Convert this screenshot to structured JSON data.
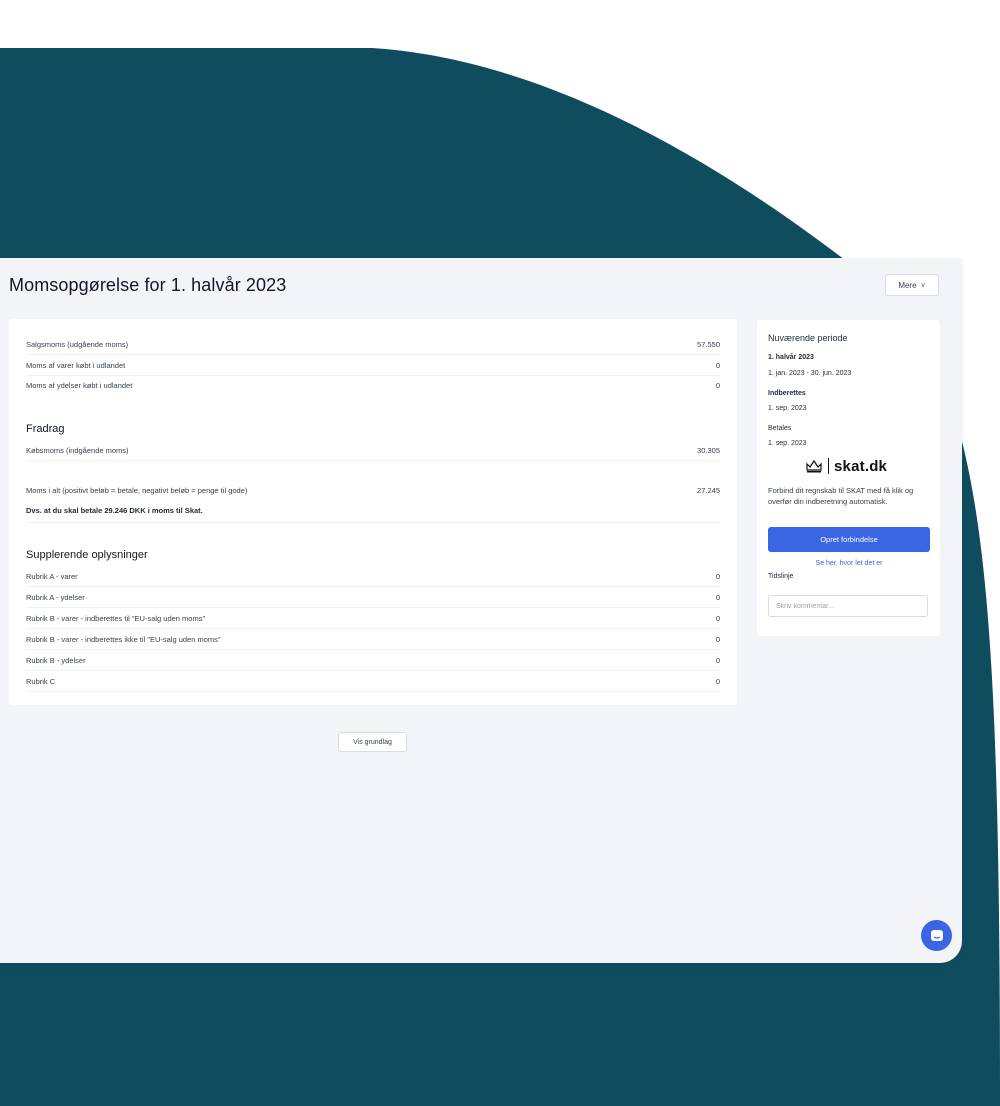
{
  "theme": {
    "blob": "#0f4d5e",
    "accent": "#3b66e3"
  },
  "header": {
    "title": "Momsopgørelse for 1. halvår 2023",
    "more_label": "Mere"
  },
  "vat_rows": [
    {
      "label": "Salgsmoms (udgående moms)",
      "value": "57.550"
    },
    {
      "label": "Moms af varer købt i udlandet",
      "value": "0"
    },
    {
      "label": "Moms af ydelser købt i udlandet",
      "value": "0"
    }
  ],
  "fradrag": {
    "title": "Fradrag",
    "rows": [
      {
        "label": "Købsmoms (indgående moms)",
        "value": "30.305"
      }
    ]
  },
  "total": {
    "label": "Moms i alt (positivt beløb = betale, negativt beløb = penge til gode)",
    "value": "27.245",
    "summary": "Dvs. at du skal betale 29.246 DKK i moms til Skat."
  },
  "supplement": {
    "title": "Supplerende oplysninger",
    "rows": [
      {
        "label": "Rubrik A - varer",
        "value": "0"
      },
      {
        "label": "Rubrik A - ydelser",
        "value": "0"
      },
      {
        "label": "Rubrik B - varer - indberettes til \"EU-salg uden moms\"",
        "value": "0"
      },
      {
        "label": "Rubrik B - varer - indberettes ikke til \"EU-salg uden moms\"",
        "value": "0"
      },
      {
        "label": "Rubrik B - ydelser",
        "value": "0"
      },
      {
        "label": "Rubrik C",
        "value": "0"
      }
    ]
  },
  "show_basis_label": "Vis grundlag",
  "sidebar": {
    "heading": "Nuværende periode",
    "period_name": "1. halvår 2023",
    "period_range": "1. jan. 2023 - 30. jun. 2023",
    "report_label": "Indberettes",
    "report_date": "1. sep. 2023",
    "pay_label": "Betales",
    "pay_date": "1. sep. 2023",
    "logo_text": "skat.dk",
    "connect_text": "Forbind dit regnskab til SKAT med få klik og overfør din indberetning automatisk.",
    "connect_button": "Opret forbindelse",
    "help_link": "Se her, hvor let det er",
    "timeline_label": "Tidslinje",
    "comment_placeholder": "Skriv kommentar..."
  },
  "icons": {
    "more": "chevron-down-icon",
    "logo": "crown-icon",
    "chat": "chat-icon"
  }
}
